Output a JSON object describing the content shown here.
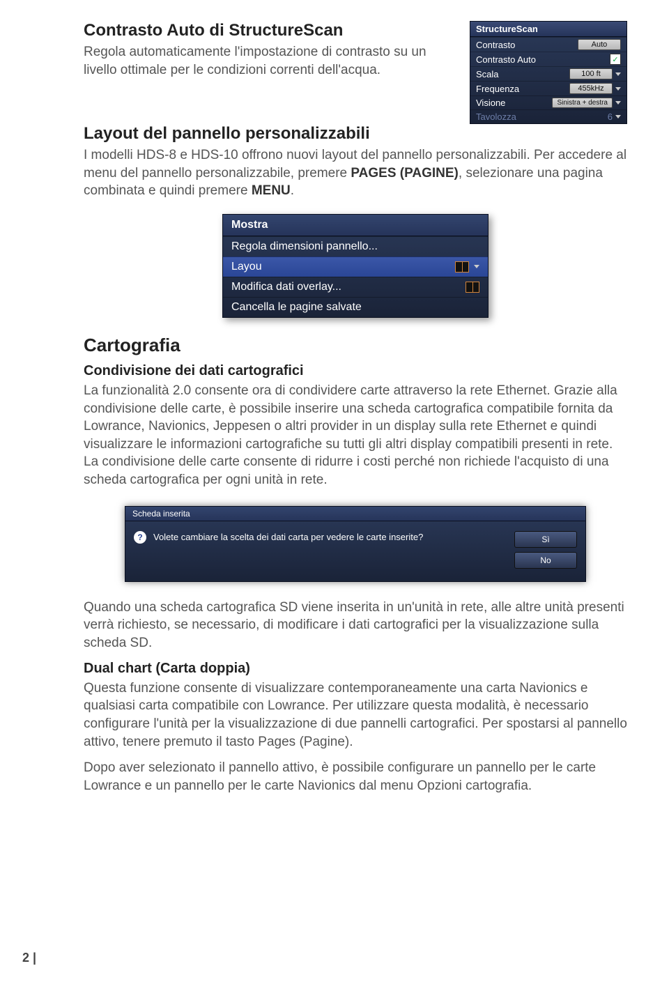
{
  "section1": {
    "title": "Contrasto Auto di StructureScan",
    "body": "Regola automaticamente l'impostazione di contrasto su un livello ottimale per le condizioni correnti dell'acqua."
  },
  "ss_panel": {
    "header": "StructureScan",
    "rows": {
      "contrasto": {
        "label": "Contrasto",
        "value": "Auto"
      },
      "contrasto_auto": {
        "label": "Contrasto Auto"
      },
      "scala": {
        "label": "Scala",
        "value": "100 ft"
      },
      "frequenza": {
        "label": "Frequenza",
        "value": "455kHz"
      },
      "visione": {
        "label": "Visione",
        "value": "Sinistra + destra"
      },
      "tavolozza": {
        "label": "Tavolozza",
        "value": "6"
      }
    }
  },
  "section2": {
    "title": "Layout del pannello personalizzabili",
    "body_parts": {
      "p1": "I modelli HDS-8 e HDS-10 offrono nuovi layout del pannello personalizzabili. Per accedere al menu del pannello personalizzabile, premere ",
      "b1": "PAGES (PAGINE)",
      "p2": ", selezionare una pagina combinata e quindi premere ",
      "b2": "MENU",
      "p3": "."
    }
  },
  "mostra": {
    "header": "Mostra",
    "items": {
      "regola": "Regola dimensioni pannello...",
      "layou": "Layou",
      "modifica": "Modifica dati overlay...",
      "cancella": "Cancella le pagine salvate"
    }
  },
  "cartografia": {
    "title": "Cartografia",
    "sub1": "Condivisione dei dati cartografici",
    "body1": "La funzionalità 2.0 consente ora di condividere carte attraverso la rete Ethernet. Grazie alla condivisione delle carte, è possibile inserire una scheda cartografica compatibile fornita da Lowrance, Navionics, Jeppesen o altri provider in un display sulla rete Ethernet e quindi visualizzare le informazioni cartografiche su tutti gli altri display compatibili presenti in rete. La condivisione delle carte consente di ridurre i costi perché non richiede l'acquisto di una scheda cartografica per ogni unità in rete."
  },
  "dialog": {
    "title": "Scheda inserita",
    "message": "Volete cambiare la scelta dei dati carta per vedere le carte inserite?",
    "yes": "Sì",
    "no": "No"
  },
  "after_dialog": "Quando una scheda cartografica SD viene inserita in un'unità in rete, alle altre unità presenti verrà richiesto, se necessario, di modificare i dati cartografici per la visualizzazione sulla scheda SD.",
  "dual": {
    "title": "Dual chart (Carta doppia)",
    "body1": "Questa funzione consente di visualizzare contemporaneamente una carta Navionics e qualsiasi carta compatibile con Lowrance. Per utilizzare questa modalità, è necessario configurare l'unità per la visualizzazione di due pannelli cartografici. Per spostarsi al pannello attivo, tenere premuto il tasto Pages (Pagine).",
    "body2": "Dopo aver selezionato il pannello attivo, è possibile configurare un pannello per le carte Lowrance e un pannello per le carte Navionics dal menu Opzioni cartografia."
  },
  "page_number": "2 |"
}
